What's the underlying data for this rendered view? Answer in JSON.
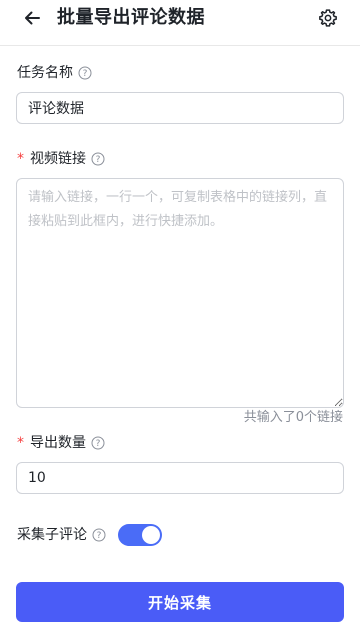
{
  "header": {
    "title": "批量导出评论数据",
    "back_icon": "arrow-left-icon",
    "settings_icon": "gear-icon"
  },
  "form": {
    "task_name": {
      "label": "任务名称",
      "value": "评论数据"
    },
    "video_links": {
      "label": "视频链接",
      "required_mark": "*",
      "placeholder": "请输入链接，一行一个，可复制表格中的链接列，直接粘贴到此框内，进行快捷添加。",
      "counter": "共输入了0个链接"
    },
    "export_count": {
      "label": "导出数量",
      "required_mark": "*",
      "value": "10"
    },
    "collect_sub_comments": {
      "label": "采集子评论",
      "enabled": true
    }
  },
  "start_button": {
    "label": "开始采集"
  },
  "colors": {
    "accent": "#4a5cf7",
    "required": "#f53f3f"
  }
}
